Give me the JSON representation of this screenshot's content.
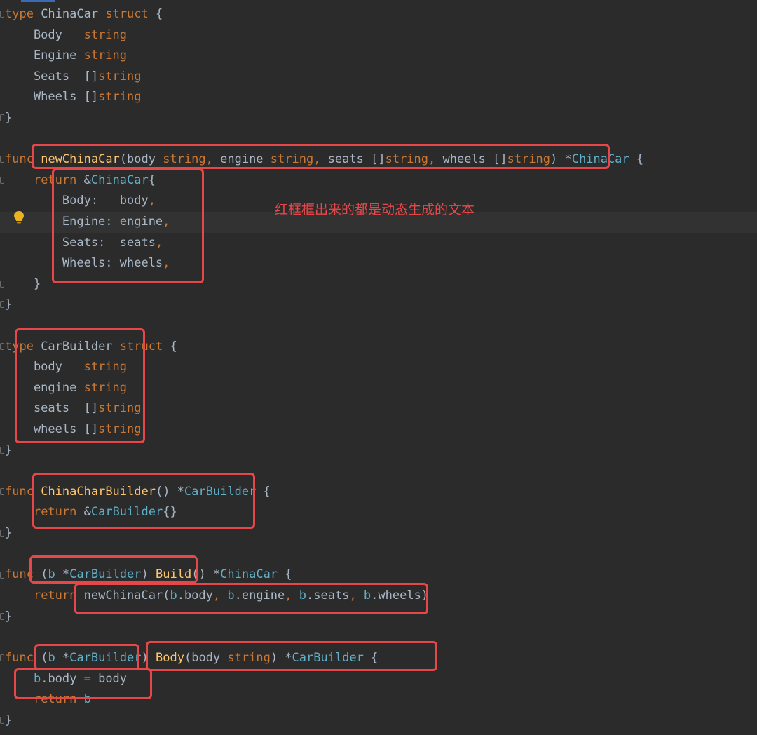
{
  "annotation": "红框框出来的都是动态生成的文本",
  "accent_colors": {
    "keyword": "#cc7832",
    "function": "#ffc66d",
    "type": "#5fb0c8",
    "text": "#a9b7c6",
    "highlight_box": "#e8474a"
  },
  "code": {
    "l1": [
      {
        "t": "type",
        "c": "kw"
      },
      {
        "t": " ChinaCar ",
        "c": "plain"
      },
      {
        "t": "struct",
        "c": "kw"
      },
      {
        "t": " {",
        "c": "plain"
      }
    ],
    "l2": [
      {
        "t": "    Body   ",
        "c": "plain"
      },
      {
        "t": "string",
        "c": "kw"
      }
    ],
    "l3": [
      {
        "t": "    Engine ",
        "c": "plain"
      },
      {
        "t": "string",
        "c": "kw"
      }
    ],
    "l4": [
      {
        "t": "    Seats  []",
        "c": "plain"
      },
      {
        "t": "string",
        "c": "kw"
      }
    ],
    "l5": [
      {
        "t": "    Wheels []",
        "c": "plain"
      },
      {
        "t": "string",
        "c": "kw"
      }
    ],
    "l6": [
      {
        "t": "}",
        "c": "plain"
      }
    ],
    "l7": [
      {
        "t": "func",
        "c": "kw"
      },
      {
        "t": " ",
        "c": "plain"
      },
      {
        "t": "newChinaCar",
        "c": "fn"
      },
      {
        "t": "(body ",
        "c": "plain"
      },
      {
        "t": "string",
        "c": "kw"
      },
      {
        "t": ", ",
        "c": "kw"
      },
      {
        "t": "engine ",
        "c": "plain"
      },
      {
        "t": "string",
        "c": "kw"
      },
      {
        "t": ", ",
        "c": "kw"
      },
      {
        "t": "seats []",
        "c": "plain"
      },
      {
        "t": "string",
        "c": "kw"
      },
      {
        "t": ", ",
        "c": "kw"
      },
      {
        "t": "wheels []",
        "c": "plain"
      },
      {
        "t": "string",
        "c": "kw"
      },
      {
        "t": ") *",
        "c": "plain"
      },
      {
        "t": "ChinaCar",
        "c": "ty"
      },
      {
        "t": " {",
        "c": "plain"
      }
    ],
    "l8": [
      {
        "t": "    ",
        "c": "plain"
      },
      {
        "t": "return",
        "c": "kw"
      },
      {
        "t": " &",
        "c": "plain"
      },
      {
        "t": "ChinaCar",
        "c": "ty"
      },
      {
        "t": "{",
        "c": "plain"
      }
    ],
    "l9": [
      {
        "t": "        Body:   body",
        "c": "plain"
      },
      {
        "t": ",",
        "c": "kw"
      }
    ],
    "l10": [
      {
        "t": "        Engine: engine",
        "c": "plain"
      },
      {
        "t": ",",
        "c": "kw"
      }
    ],
    "l11": [
      {
        "t": "        Seats:  seats",
        "c": "plain"
      },
      {
        "t": ",",
        "c": "kw"
      }
    ],
    "l12": [
      {
        "t": "        Wheels: wheels",
        "c": "plain"
      },
      {
        "t": ",",
        "c": "kw"
      }
    ],
    "l13": [
      {
        "t": "    }",
        "c": "plain"
      }
    ],
    "l14": [
      {
        "t": "}",
        "c": "plain"
      }
    ],
    "l15": [
      {
        "t": "type",
        "c": "kw"
      },
      {
        "t": " CarBuilder ",
        "c": "plain"
      },
      {
        "t": "struct",
        "c": "kw"
      },
      {
        "t": " {",
        "c": "plain"
      }
    ],
    "l16": [
      {
        "t": "    body   ",
        "c": "plain"
      },
      {
        "t": "string",
        "c": "kw"
      }
    ],
    "l17": [
      {
        "t": "    engine ",
        "c": "plain"
      },
      {
        "t": "string",
        "c": "kw"
      }
    ],
    "l18": [
      {
        "t": "    seats  []",
        "c": "plain"
      },
      {
        "t": "string",
        "c": "kw"
      }
    ],
    "l19": [
      {
        "t": "    wheels []",
        "c": "plain"
      },
      {
        "t": "string",
        "c": "kw"
      }
    ],
    "l20": [
      {
        "t": "}",
        "c": "plain"
      }
    ],
    "l21": [
      {
        "t": "func",
        "c": "kw"
      },
      {
        "t": " ",
        "c": "plain"
      },
      {
        "t": "ChinaCharBuilder",
        "c": "fn"
      },
      {
        "t": "() *",
        "c": "plain"
      },
      {
        "t": "CarBuilder",
        "c": "ty"
      },
      {
        "t": " {",
        "c": "plain"
      }
    ],
    "l22": [
      {
        "t": "    ",
        "c": "plain"
      },
      {
        "t": "return",
        "c": "kw"
      },
      {
        "t": " &",
        "c": "plain"
      },
      {
        "t": "CarBuilder",
        "c": "ty"
      },
      {
        "t": "{}",
        "c": "plain"
      }
    ],
    "l23": [
      {
        "t": "}",
        "c": "plain"
      }
    ],
    "l24": [
      {
        "t": "func",
        "c": "kw"
      },
      {
        "t": " (",
        "c": "plain"
      },
      {
        "t": "b",
        "c": "rc"
      },
      {
        "t": " *",
        "c": "plain"
      },
      {
        "t": "CarBuilder",
        "c": "ty"
      },
      {
        "t": ") ",
        "c": "plain"
      },
      {
        "t": "Build",
        "c": "fn"
      },
      {
        "t": "() *",
        "c": "plain"
      },
      {
        "t": "ChinaCar",
        "c": "ty"
      },
      {
        "t": " {",
        "c": "plain"
      }
    ],
    "l25": [
      {
        "t": "    ",
        "c": "plain"
      },
      {
        "t": "return",
        "c": "kw"
      },
      {
        "t": " newChinaCar(",
        "c": "plain"
      },
      {
        "t": "b",
        "c": "rc"
      },
      {
        "t": ".body",
        "c": "plain"
      },
      {
        "t": ", ",
        "c": "kw"
      },
      {
        "t": "b",
        "c": "rc"
      },
      {
        "t": ".engine",
        "c": "plain"
      },
      {
        "t": ", ",
        "c": "kw"
      },
      {
        "t": "b",
        "c": "rc"
      },
      {
        "t": ".seats",
        "c": "plain"
      },
      {
        "t": ", ",
        "c": "kw"
      },
      {
        "t": "b",
        "c": "rc"
      },
      {
        "t": ".wheels)",
        "c": "plain"
      }
    ],
    "l26": [
      {
        "t": "}",
        "c": "plain"
      }
    ],
    "l27": [
      {
        "t": "func",
        "c": "kw"
      },
      {
        "t": " (",
        "c": "plain"
      },
      {
        "t": "b",
        "c": "rc"
      },
      {
        "t": " *",
        "c": "plain"
      },
      {
        "t": "CarBuilder",
        "c": "ty"
      },
      {
        "t": ") ",
        "c": "plain"
      },
      {
        "t": "Body",
        "c": "fn"
      },
      {
        "t": "(body ",
        "c": "plain"
      },
      {
        "t": "string",
        "c": "kw"
      },
      {
        "t": ") *",
        "c": "plain"
      },
      {
        "t": "CarBuilder",
        "c": "ty"
      },
      {
        "t": " {",
        "c": "plain"
      }
    ],
    "l28": [
      {
        "t": "    ",
        "c": "plain"
      },
      {
        "t": "b",
        "c": "rc"
      },
      {
        "t": ".body = body",
        "c": "plain"
      }
    ],
    "l29": [
      {
        "t": "    ",
        "c": "plain"
      },
      {
        "t": "return",
        "c": "kw"
      },
      {
        "t": " ",
        "c": "plain"
      },
      {
        "t": "b",
        "c": "rc"
      }
    ],
    "l30": [
      {
        "t": "}",
        "c": "plain"
      }
    ]
  }
}
